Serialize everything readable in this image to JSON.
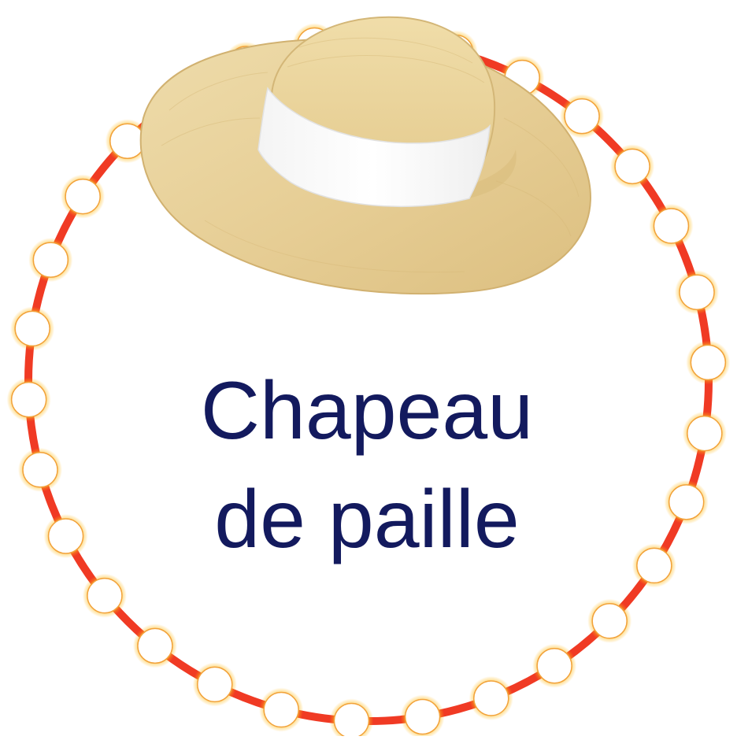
{
  "caption": {
    "line1": "Chapeau",
    "line2": "de paille"
  },
  "colors": {
    "ring": "#f03a24",
    "bead_fill": "#ffffff",
    "bead_glow": "#ffd24a",
    "text": "#131a5e",
    "hat_straw": "#e9d29a",
    "hat_straw_dark": "#d7b979",
    "hat_band": "#ffffff"
  },
  "icons": {
    "hat": "straw-hat-icon",
    "ring": "bead-ring-frame"
  }
}
